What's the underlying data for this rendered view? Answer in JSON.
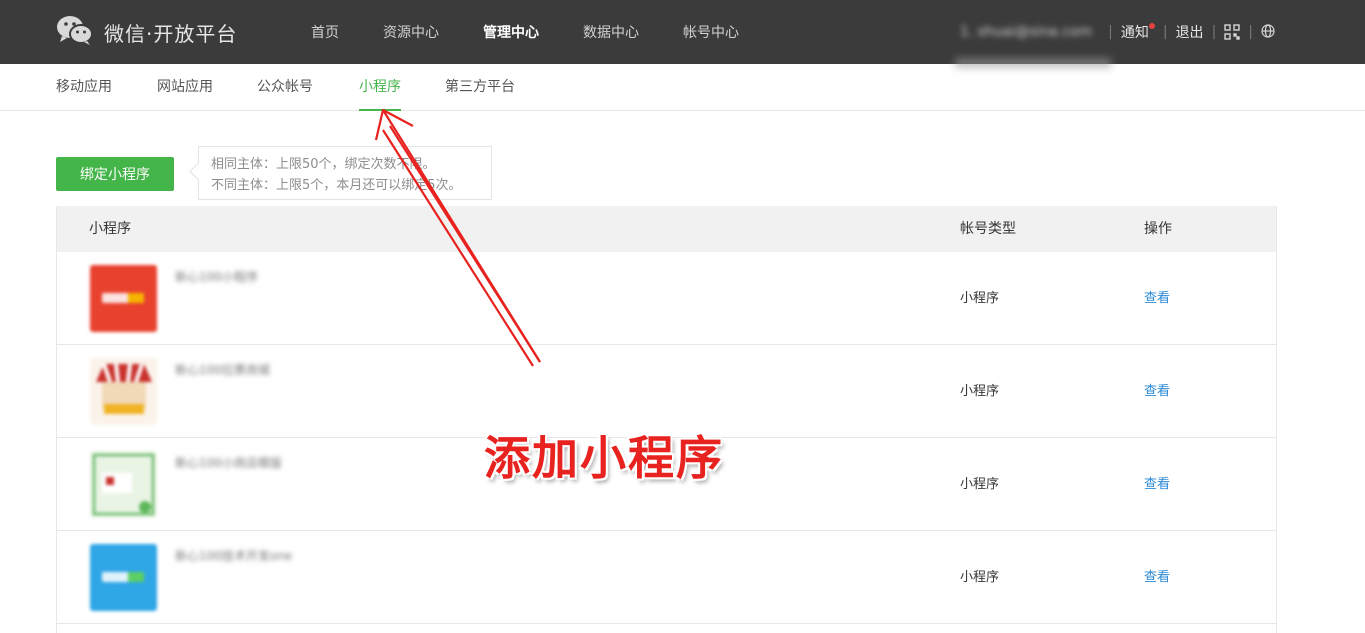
{
  "header": {
    "brand": "微信·开放平台",
    "nav": [
      "首页",
      "资源中心",
      "管理中心",
      "数据中心",
      "帐号中心"
    ],
    "active_nav": "管理中心",
    "user_email": "1. shuai@sina.com",
    "notify": "通知",
    "logout": "退出"
  },
  "subnav": {
    "items": [
      "移动应用",
      "网站应用",
      "公众帐号",
      "小程序",
      "第三方平台"
    ],
    "active": "小程序"
  },
  "bind": {
    "button": "绑定小程序",
    "tip_line1": "相同主体：上限50个，绑定次数不限。",
    "tip_line2": "不同主体：上限5个，本月还可以绑定5次。"
  },
  "table": {
    "headers": [
      "小程序",
      "帐号类型",
      "操作"
    ],
    "rows": [
      {
        "name": "新心100小程序",
        "type": "小程序",
        "action": "查看",
        "icon_color": "#e8412e"
      },
      {
        "name": "新心100拉票商城",
        "type": "小程序",
        "action": "查看",
        "icon_color": "#f3e7d9"
      },
      {
        "name": "新心100小商店模版",
        "type": "小程序",
        "action": "查看",
        "icon_color": "#e3f0df"
      },
      {
        "name": "新心100技术开发one",
        "type": "小程序",
        "action": "查看",
        "icon_color": "#2fa6e6"
      }
    ]
  },
  "annotation": {
    "callout": "添加小程序"
  },
  "colors": {
    "topbar": "#3b3b3b",
    "accent_green": "#44b549",
    "link_blue": "#2d8ad6",
    "annotation_red": "#e8221f"
  }
}
